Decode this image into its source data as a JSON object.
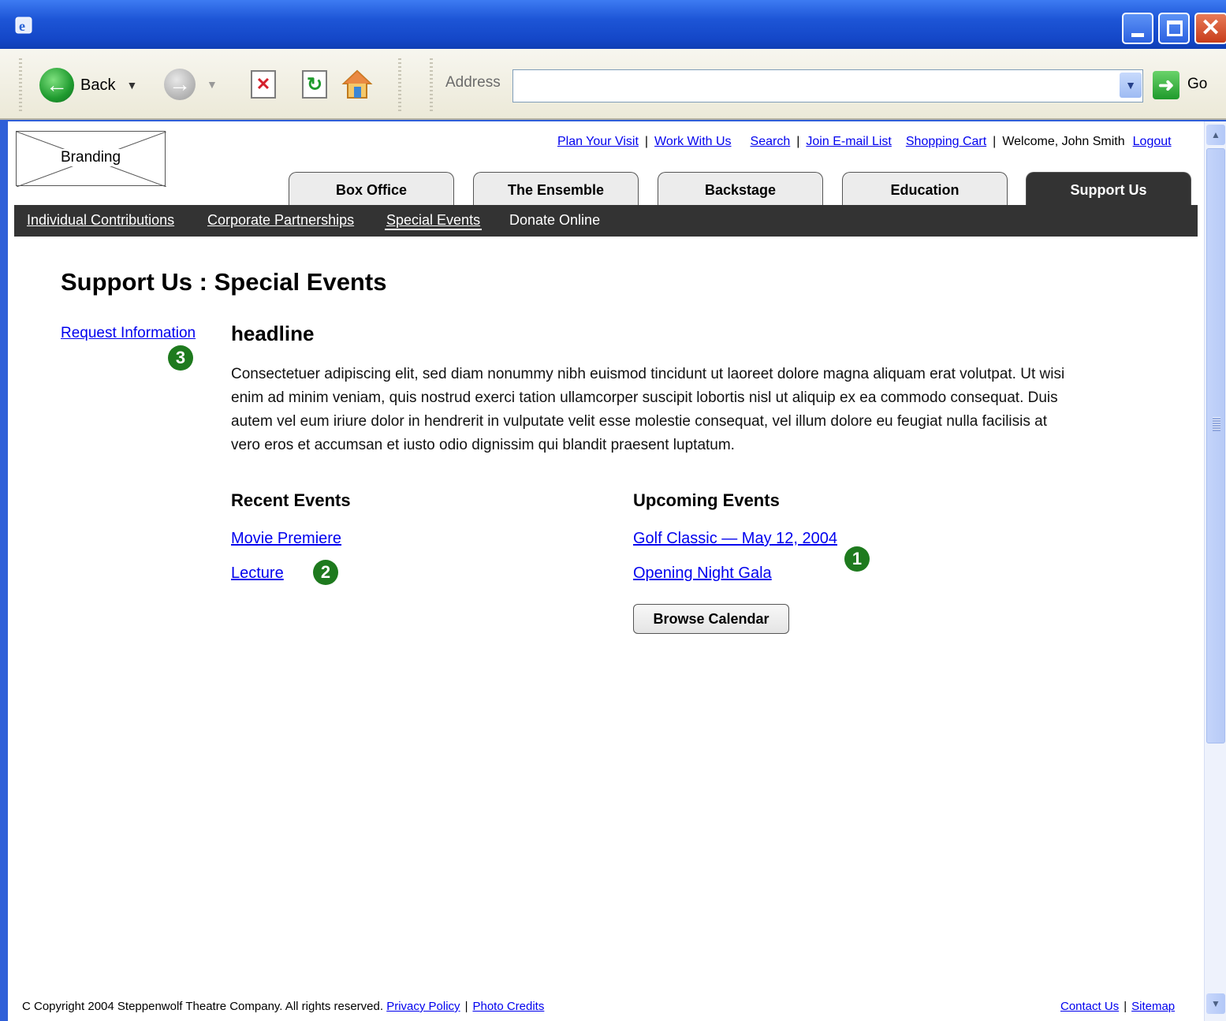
{
  "browser": {
    "back_label": "Back",
    "address_label": "Address",
    "address_value": "",
    "go_label": "Go",
    "icons": [
      "ie-icon",
      "back-icon",
      "forward-icon",
      "stop-icon",
      "refresh-icon",
      "home-icon"
    ]
  },
  "site": {
    "branding": "Branding",
    "utility": {
      "plan_visit": "Plan Your Visit",
      "work_with_us": "Work With Us",
      "search": "Search",
      "join_email": "Join E-mail List",
      "shopping_cart": "Shopping Cart",
      "welcome": "Welcome, John Smith",
      "logout": "Logout",
      "separator": "|"
    },
    "tabs": [
      {
        "label": "Box Office"
      },
      {
        "label": "The Ensemble"
      },
      {
        "label": "Backstage"
      },
      {
        "label": "Education"
      },
      {
        "label": "Support Us"
      }
    ],
    "active_tab": "Support Us",
    "subnav": [
      {
        "label": "Individual Contributions"
      },
      {
        "label": "Corporate Partnerships"
      },
      {
        "label": "Special Events"
      },
      {
        "label": "Donate Online"
      }
    ],
    "active_subnav": "Special Events"
  },
  "main": {
    "title": "Support Us  : Special Events",
    "request_info": "Request Information",
    "headline": "headline",
    "body": "Consectetuer adipiscing elit, sed diam nonummy nibh euismod tincidunt ut laoreet dolore magna aliquam erat volutpat. Ut wisi enim ad minim veniam, quis nostrud exerci tation ullamcorper suscipit lobortis nisl ut aliquip ex ea commodo consequat. Duis autem vel eum iriure dolor in hendrerit in vulputate velit esse molestie consequat, vel illum dolore eu feugiat nulla facilisis at vero eros et accumsan et iusto odio dignissim qui blandit praesent luptatum.",
    "recent": {
      "title": "Recent Events",
      "items": [
        "Movie Premiere",
        "Lecture"
      ]
    },
    "upcoming": {
      "title": "Upcoming Events",
      "items": [
        "Golf Classic — May 12, 2004",
        "Opening Night Gala"
      ],
      "browse_button": "Browse Calendar"
    },
    "badges": [
      "1",
      "2",
      "3"
    ]
  },
  "footer": {
    "copyright": "C Copyright 2004 Steppenwolf Theatre Company. All rights reserved.",
    "privacy": "Privacy Policy",
    "photo_credits": "Photo Credits",
    "contact": "Contact Us",
    "sitemap": "Sitemap",
    "separator": "|"
  },
  "colors": {
    "titlebar": "#1d55d6",
    "nav_dark": "#333333",
    "link": "#0000ee",
    "badge": "#1e7a1e"
  }
}
